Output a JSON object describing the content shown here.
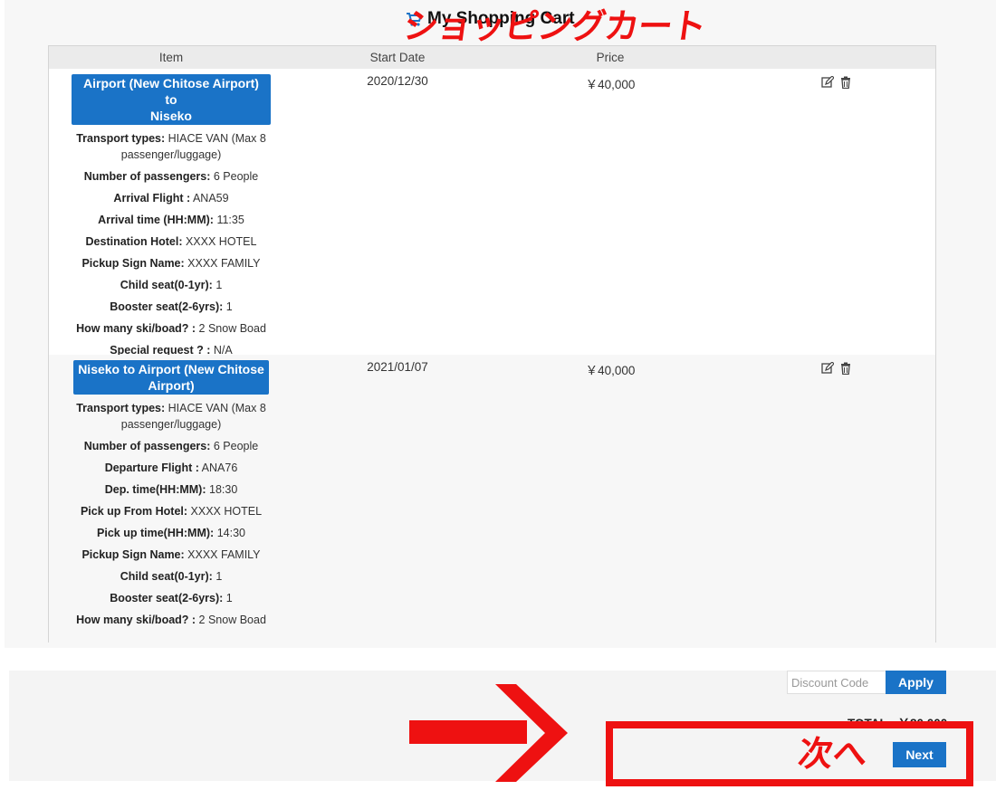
{
  "header": {
    "title": "My Shopping Cart",
    "annotation_jp": "ショッピングカート"
  },
  "table": {
    "columns": [
      "Item",
      "Start Date",
      "Price",
      ""
    ],
    "rows": [
      {
        "title_line1": "Airport (New Chitose Airport) to",
        "title_line2": "Niseko",
        "start_date": "2020/12/30",
        "price": "￥40,000",
        "details": [
          {
            "label": "Transport types:",
            "value": "HIACE VAN (Max 8 passenger/luggage)"
          },
          {
            "label": "Number of passengers:",
            "value": "6 People"
          },
          {
            "label": "Arrival Flight :",
            "value": "ANA59"
          },
          {
            "label": "Arrival time (HH:MM):",
            "value": "11:35"
          },
          {
            "label": "Destination Hotel:",
            "value": "XXXX HOTEL"
          },
          {
            "label": "Pickup Sign Name:",
            "value": "XXXX FAMILY"
          },
          {
            "label": "Child seat(0-1yr):",
            "value": "1"
          },
          {
            "label": "Booster seat(2-6yrs):",
            "value": "1"
          },
          {
            "label": "How many ski/boad? :",
            "value": "2 Snow Boad"
          },
          {
            "label": "Special request ? :",
            "value": "N/A"
          }
        ]
      },
      {
        "title_line1": "Niseko to Airport (New Chitose",
        "title_line2": "Airport)",
        "start_date": "2021/01/07",
        "price": "￥40,000",
        "details": [
          {
            "label": "Transport types:",
            "value": "HIACE VAN (Max 8 passenger/luggage)"
          },
          {
            "label": "Number of passengers:",
            "value": "6 People"
          },
          {
            "label": "Departure Flight :",
            "value": "ANA76"
          },
          {
            "label": "Dep. time(HH:MM):",
            "value": "18:30"
          },
          {
            "label": "Pick up From Hotel:",
            "value": "XXXX HOTEL"
          },
          {
            "label": "Pick up time(HH:MM):",
            "value": "14:30"
          },
          {
            "label": "Pickup Sign Name:",
            "value": "XXXX FAMILY"
          },
          {
            "label": "Child seat(0-1yr):",
            "value": "1"
          },
          {
            "label": "Booster seat(2-6yrs):",
            "value": "1"
          },
          {
            "label": "How many ski/boad? :",
            "value": "2 Snow Boad"
          }
        ]
      }
    ]
  },
  "footer": {
    "discount_placeholder": "Discount Code",
    "apply_label": "Apply",
    "total_text": "TOTAL : ￥80,000",
    "next_annotation_jp": "次へ",
    "next_label": "Next"
  },
  "colors": {
    "accent_blue": "#1a73c7",
    "annotation_red": "#ee1111"
  },
  "icons": {
    "cart": "shopping-cart-icon",
    "edit": "edit-icon",
    "delete": "trash-icon",
    "arrow": "red-arrow-icon"
  }
}
